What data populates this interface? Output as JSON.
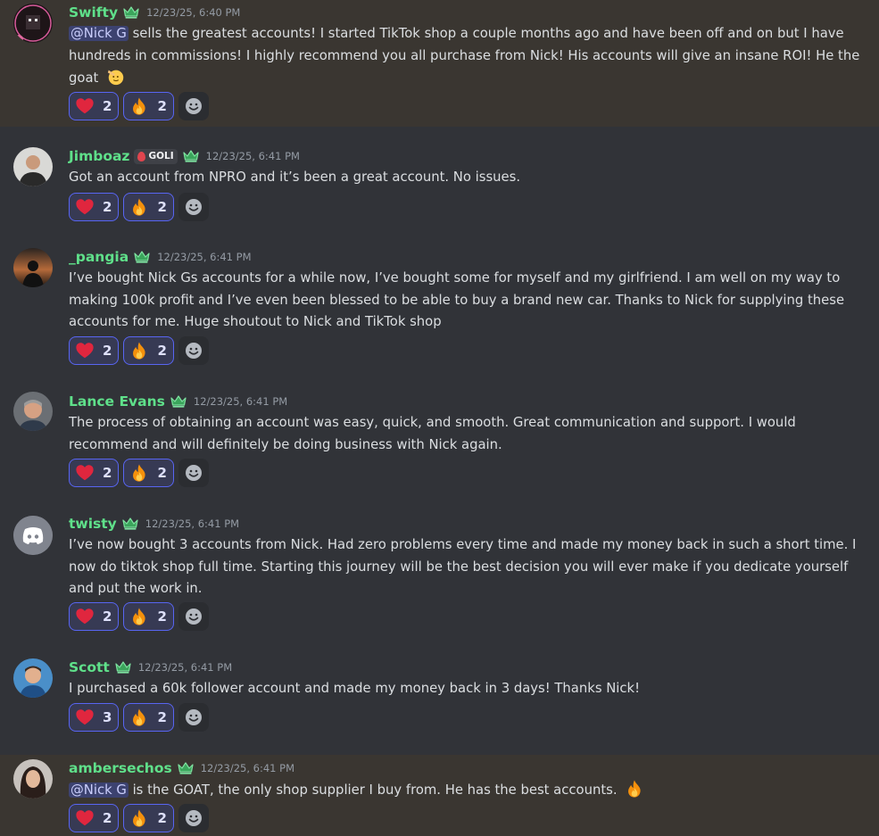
{
  "messages": [
    {
      "username": "Swifty",
      "timestamp": "12/23/25, 6:40 PM",
      "mention": "@Nick G",
      "text": " sells the greatest accounts! I started TikTok shop a couple months ago and have been off and on but I have hundreds in commissions! I highly recommend you all purchase from Nick! His accounts will give an insane ROI! He the goat",
      "reactions": [
        {
          "emoji": "heart-icon",
          "count": "2"
        },
        {
          "emoji": "fire-icon",
          "count": "2"
        }
      ]
    },
    {
      "username": "Jimboaz",
      "tag": "GOLI",
      "timestamp": "12/23/25, 6:41 PM",
      "text": "Got an account from NPRO and it’s been a great account. No issues.",
      "reactions": [
        {
          "emoji": "heart-icon",
          "count": "2"
        },
        {
          "emoji": "fire-icon",
          "count": "2"
        }
      ]
    },
    {
      "username": "_pangia",
      "timestamp": "12/23/25, 6:41 PM",
      "text": "I’ve bought Nick Gs accounts for a while now, I’ve bought some for myself and my girlfriend. I am well on my way to making 100k profit and I’ve even been blessed to be able to buy a brand new car. Thanks to Nick for supplying these accounts for me. Huge shoutout to Nick and TikTok shop",
      "reactions": [
        {
          "emoji": "heart-icon",
          "count": "2"
        },
        {
          "emoji": "fire-icon",
          "count": "2"
        }
      ]
    },
    {
      "username": "Lance Evans",
      "timestamp": "12/23/25, 6:41 PM",
      "text": "The process of obtaining an account was easy, quick, and smooth. Great communication and support. I would recommend and will definitely be doing business with Nick again.",
      "reactions": [
        {
          "emoji": "heart-icon",
          "count": "2"
        },
        {
          "emoji": "fire-icon",
          "count": "2"
        }
      ]
    },
    {
      "username": "twisty",
      "timestamp": "12/23/25, 6:41 PM",
      "text": "I’ve now bought 3 accounts from Nick. Had zero problems every time and made my money back in such a short time. I now do tiktok shop full time. Starting this journey will be the best decision you will ever make if you dedicate yourself and put the work in.",
      "reactions": [
        {
          "emoji": "heart-icon",
          "count": "2"
        },
        {
          "emoji": "fire-icon",
          "count": "2"
        }
      ]
    },
    {
      "username": "Scott",
      "timestamp": "12/23/25, 6:41 PM",
      "text": "I purchased a 60k follower account and made my money back in 3 days! Thanks Nick!",
      "reactions": [
        {
          "emoji": "heart-icon",
          "count": "3"
        },
        {
          "emoji": "fire-icon",
          "count": "2"
        }
      ]
    },
    {
      "username": "ambersechos",
      "timestamp": "12/23/25, 6:41 PM",
      "mention": "@Nick G",
      "text": " is the GOAT, the only shop supplier I buy from. He has the best accounts.",
      "reactions": [
        {
          "emoji": "heart-icon",
          "count": "2"
        },
        {
          "emoji": "fire-icon",
          "count": "2"
        }
      ]
    }
  ],
  "colors": {
    "background": "#313338",
    "highlight": "#3a3631",
    "username": "#5fe08a",
    "mention_bg": "#3c4270",
    "reaction_border": "#5865f2"
  }
}
